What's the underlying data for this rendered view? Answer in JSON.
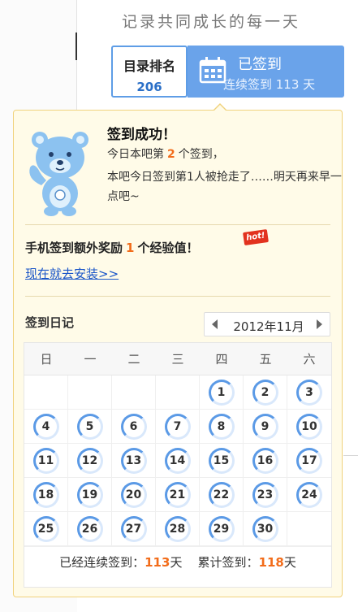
{
  "header": {
    "slogan": "记录共同成长的每一天",
    "rank": {
      "label": "目录排名",
      "value": "206"
    },
    "signed": {
      "title": "已签到",
      "streak_text": "连续签到 113 天"
    }
  },
  "popup": {
    "title": "签到成功！",
    "line1": {
      "prefix": "今日本吧第",
      "count": "2",
      "suffix": "个签到，"
    },
    "line2": "本吧今日签到第1人被抢走了……明天再来早一点吧~",
    "bonus": {
      "prefix": "手机签到额外奖励",
      "count": "1",
      "suffix": "个经验值！",
      "badge": "hot!"
    },
    "install_link": "现在就去安装>>",
    "diary_title": "签到日记",
    "month": "2012年11月",
    "weekdays": [
      "日",
      "一",
      "二",
      "三",
      "四",
      "五",
      "六"
    ],
    "days": [
      "",
      "",
      "",
      "",
      "1",
      "2",
      "3",
      "4",
      "5",
      "6",
      "7",
      "8",
      "9",
      "10",
      "11",
      "12",
      "13",
      "14",
      "15",
      "16",
      "17",
      "18",
      "19",
      "20",
      "21",
      "22",
      "23",
      "24",
      "25",
      "26",
      "27",
      "28",
      "29",
      "30",
      ""
    ],
    "footer": {
      "streak_label": "已经连续签到：",
      "streak_value": "113",
      "streak_unit": "天",
      "total_label": "累计签到：",
      "total_value": "118",
      "total_unit": "天"
    }
  },
  "icons": {
    "calendar": "calendar-icon",
    "mascot": "bear-mascot-icon"
  },
  "colors": {
    "accent_blue": "#6aa3ea",
    "highlight_orange": "#f26c1a",
    "popup_bg": "#fffbe8"
  }
}
